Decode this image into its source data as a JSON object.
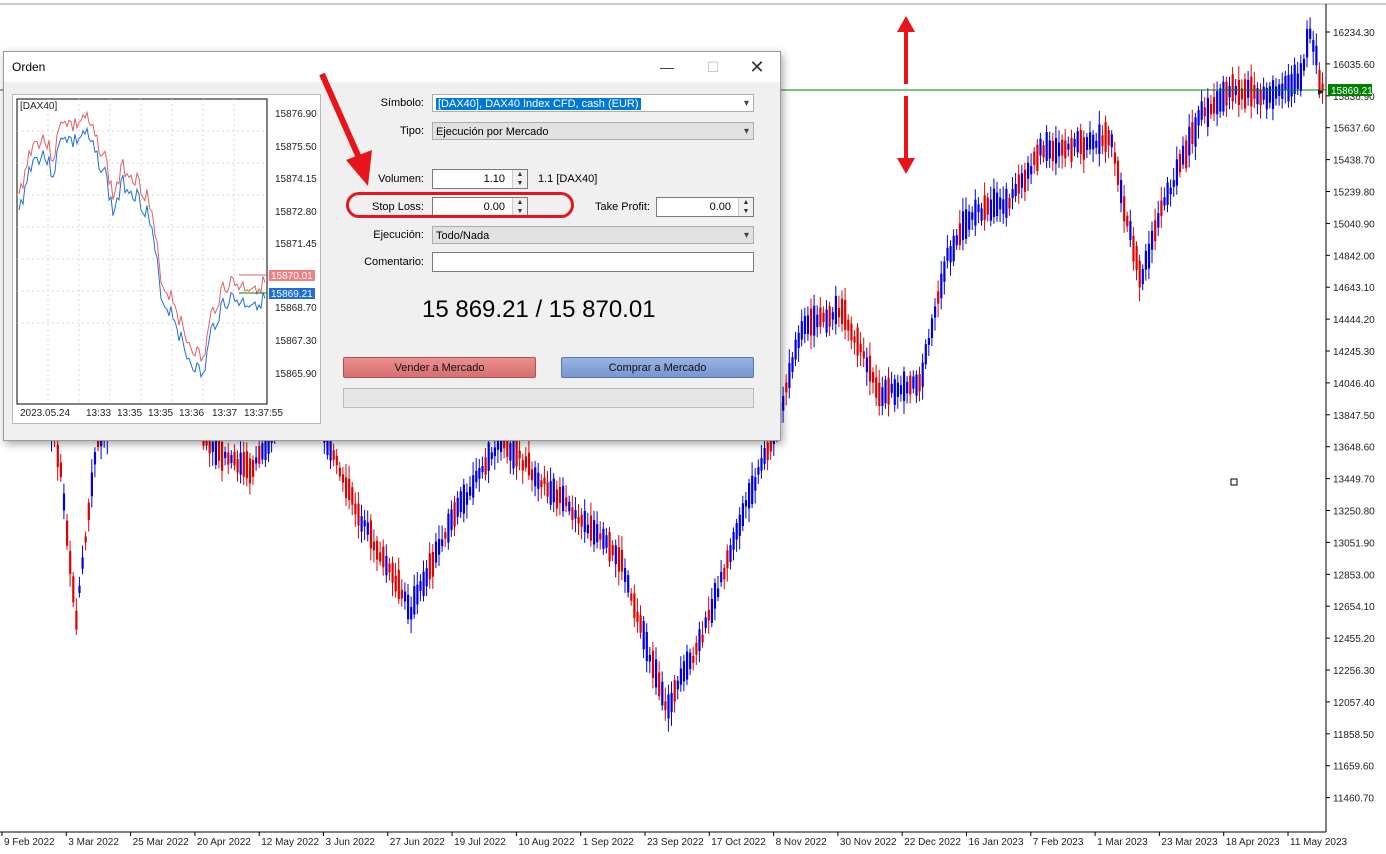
{
  "main_chart": {
    "price_labels": [
      "16234.30",
      "16035.60",
      "15836.90",
      "15637.60",
      "15438.70",
      "15239.80",
      "15040.90",
      "14842.00",
      "14643.10",
      "14444.20",
      "14245.30",
      "14046.40",
      "13847.50",
      "13648.60",
      "13449.70",
      "13250.80",
      "13051.90",
      "12853.00",
      "12654.10",
      "12455.20",
      "12256.30",
      "12057.40",
      "11858.50",
      "11659.60",
      "11460.70"
    ],
    "current_price": "15869.21",
    "date_labels": [
      "9 Feb 2022",
      "3 Mar 2022",
      "25 Mar 2022",
      "20 Apr 2022",
      "12 May 2022",
      "3 Jun 2022",
      "27 Jun 2022",
      "19 Jul 2022",
      "10 Aug 2022",
      "1 Sep 2022",
      "23 Sep 2022",
      "17 Oct 2022",
      "8 Nov 2022",
      "30 Nov 2022",
      "22 Dec 2022",
      "16 Jan 2023",
      "7 Feb 2023",
      "1 Mar 2023",
      "23 Mar 2023",
      "18 Apr 2023",
      "11 May 2023"
    ],
    "colors": {
      "bull": "#0000e0",
      "bear": "#e00000",
      "price_line": "#008000",
      "annotation": "#e8141c"
    }
  },
  "dialog": {
    "title": "Orden",
    "minimize": "—",
    "maximize": "☐",
    "close": "✕",
    "mini_chart": {
      "symbol_tag": "[DAX40]",
      "price_labels": [
        "15876.90",
        "15875.50",
        "15874.15",
        "15872.80",
        "15871.45",
        "15868.70",
        "15867.30",
        "15865.90"
      ],
      "ask_tag": "15870.01",
      "bid_tag": "15869.21",
      "time_labels": [
        "2023.05.24",
        "13:33",
        "13:35",
        "13:35",
        "13:36",
        "13:37",
        "13:37:55"
      ]
    },
    "form": {
      "symbol_label": "Símbolo:",
      "symbol_value": "[DAX40], DAX40 Index CFD, cash (EUR)",
      "type_label": "Tipo:",
      "type_value": "Ejecución por Mercado",
      "volume_label": "Volumen:",
      "volume_value": "1.10",
      "volume_info": "1.1 [DAX40]",
      "stoploss_label": "Stop Loss:",
      "stoploss_value": "0.00",
      "takeprofit_label": "Take Profit:",
      "takeprofit_value": "0.00",
      "execution_label": "Ejecución:",
      "execution_value": "Todo/Nada",
      "comment_label": "Comentario:",
      "comment_value": ""
    },
    "price_display": "15 869.21 / 15 870.01",
    "sell_button": "Vender a Mercado",
    "buy_button": "Comprar a Mercado"
  }
}
